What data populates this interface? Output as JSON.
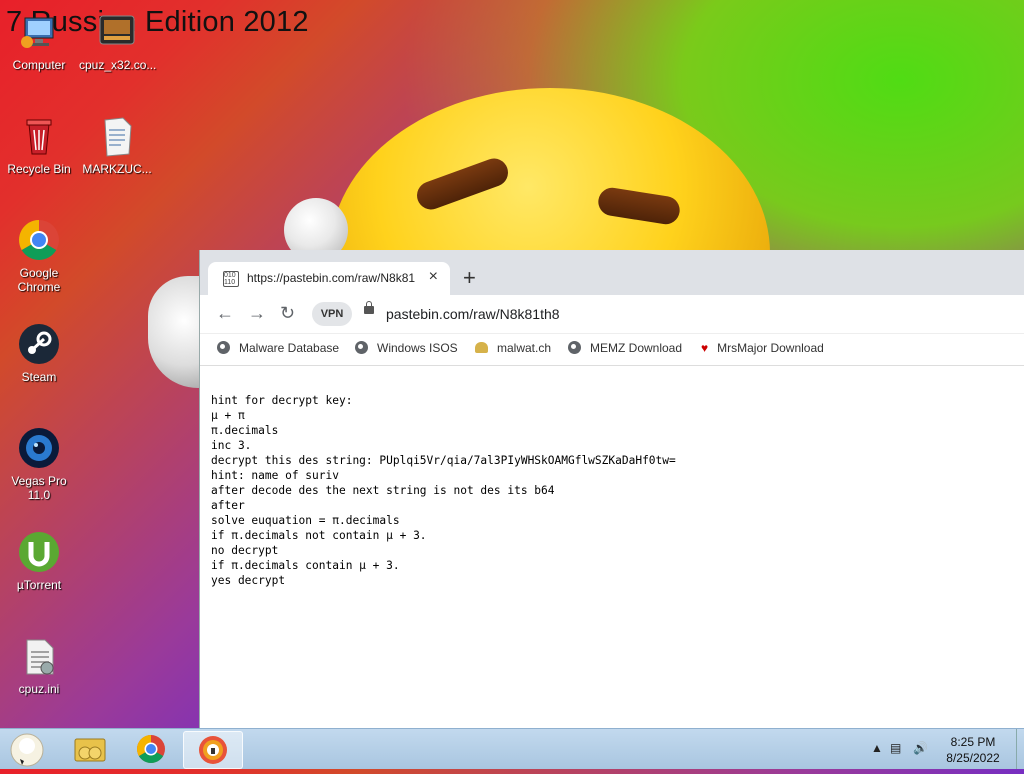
{
  "wallpaper": {
    "title": "7 Russian Edition 2012"
  },
  "desktop_icons": [
    {
      "label": "Computer",
      "icon": "computer-icon"
    },
    {
      "label": "cpuz_x32.co...",
      "icon": "application-icon"
    },
    {
      "label": "Recycle Bin",
      "icon": "recycle-bin-icon"
    },
    {
      "label": "MARKZUC...",
      "icon": "document-icon"
    },
    {
      "label": "Google Chrome",
      "icon": "chrome-icon"
    },
    {
      "label": "Steam",
      "icon": "steam-icon"
    },
    {
      "label": "Vegas Pro 11.0",
      "icon": "vegas-pro-icon"
    },
    {
      "label": "µTorrent",
      "icon": "utorrent-icon"
    },
    {
      "label": "cpuz.ini",
      "icon": "ini-file-icon"
    }
  ],
  "browser": {
    "tab_title": "https://pastebin.com/raw/N8k81",
    "new_tab_label": "+",
    "close_tab_label": "×",
    "vpn_label": "VPN",
    "address": "pastebin.com/raw/N8k81th8",
    "bookmarks": [
      {
        "label": "Malware Database",
        "icon": "globe-icon"
      },
      {
        "label": "Windows ISOS",
        "icon": "globe-icon"
      },
      {
        "label": "malwat.ch",
        "icon": "malwatch-icon"
      },
      {
        "label": "MEMZ Download",
        "icon": "globe-icon"
      },
      {
        "label": "MrsMajor Download",
        "icon": "heart-icon"
      }
    ],
    "page_lines": [
      "hint for decrypt key:",
      "µ + π",
      "π.decimals",
      "inc 3.",
      "decrypt this des string: PUplqi5Vr/qia/7al3PIyWHSkOAMGflwSZKaDaHf0tw=",
      "hint: name of suriv",
      "after decode des the next string is not des its b64",
      "after",
      "solve euquation = π.decimals",
      "if π.decimals not contain µ + 3.",
      "no decrypt",
      "if π.decimals contain µ + 3.",
      "yes decrypt"
    ]
  },
  "taskbar": {
    "time": "8:25 PM",
    "date": "8/25/2022",
    "items": [
      "start-orb-icon",
      "libraries-icon",
      "chrome-icon",
      "browser-active-icon"
    ]
  }
}
